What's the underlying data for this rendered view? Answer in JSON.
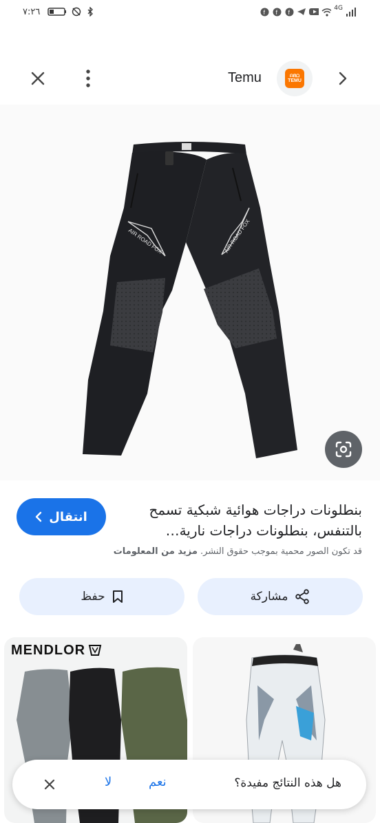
{
  "status_bar": {
    "time": "٧:٢٦",
    "network": "4G"
  },
  "header": {
    "site_name": "Temu",
    "logo_text_top": "ᗩᗰᗝ",
    "logo_text_bottom": "TEMU",
    "icons": [
      "close-icon",
      "more-vert-icon",
      "chevron-right-icon"
    ]
  },
  "product": {
    "title": "بنطلونات دراجات هوائية شبكية تسمح بالتنفس، بنطلونات دراجات نارية…",
    "visit_label": "انتقال",
    "copyright_text": "قد تكون الصور محمية بموجب حقوق النشر.",
    "more_info_label": "مزيد من المعلومات",
    "pants_print": "AIR ROAD FOX"
  },
  "actions": {
    "share_label": "مشاركة",
    "save_label": "حفظ"
  },
  "related": {
    "left_brand": "MENDLOR"
  },
  "feedback": {
    "question": "هل هذه النتائج مفيدة؟",
    "yes_label": "نعم",
    "no_label": "لا"
  },
  "colors": {
    "accent": "#1a73e8",
    "chip_bg": "#e8f0fe",
    "temu_orange": "#fb7701"
  }
}
